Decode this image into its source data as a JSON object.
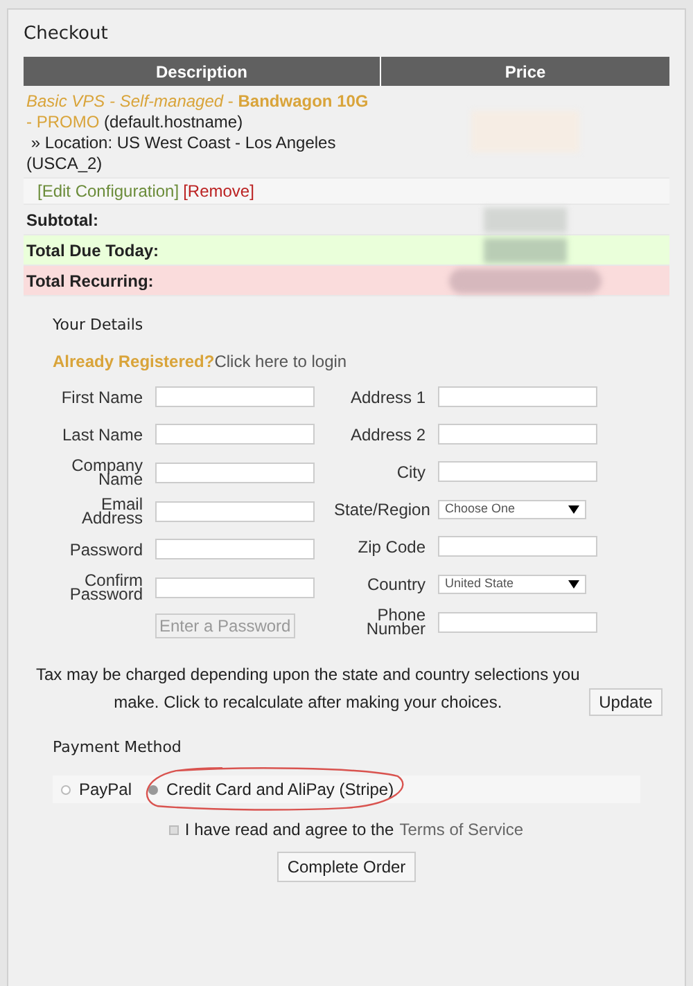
{
  "title": "Checkout",
  "table": {
    "columns": [
      "Description",
      "Price"
    ],
    "product": {
      "name": "*Basic VPS - Self-managed* - **Bandwagon 10G** - PROMO",
      "hostname": "(default.hostname)",
      "detail": "» Location: US West Coast - Los Angeles (USCA_2)"
    },
    "actions": [
      {
        "label": "[Edit Configuration]",
        "kind": "edit"
      },
      {
        "label": "[Remove]",
        "kind": "remove"
      }
    ],
    "totals": [
      {
        "label": "Subtotal:",
        "kind": "plain"
      },
      {
        "label": "Total Due Today:",
        "kind": "due"
      },
      {
        "label": "Total Recurring:",
        "kind": "recurring"
      }
    ]
  },
  "details": {
    "heading": "Your Details",
    "login_prompt": "Already Registered?",
    "login_link": "Click here to login",
    "left_fields": [
      {
        "label": "First Name",
        "kind": "input"
      },
      {
        "label": "Last Name",
        "kind": "input"
      },
      {
        "label": "Company Name",
        "kind": "input"
      },
      {
        "label": "Email Address",
        "kind": "input"
      },
      {
        "label": "Password",
        "kind": "input"
      },
      {
        "label": "Confirm Password",
        "kind": "input"
      }
    ],
    "password_strength": "Enter a Password",
    "right_fields": [
      {
        "label": "Address 1",
        "kind": "input"
      },
      {
        "label": "Address 2",
        "kind": "input"
      },
      {
        "label": "City",
        "kind": "input"
      },
      {
        "label": "State/Region",
        "kind": "select",
        "value": "Choose One"
      },
      {
        "label": "Zip Code",
        "kind": "input"
      },
      {
        "label": "Country",
        "kind": "select",
        "value": "United State"
      },
      {
        "label": "Phone Number",
        "kind": "input"
      }
    ]
  },
  "tax_note": "Tax may be charged depending upon the state and country selections you make. Click to recalculate after making your choices.",
  "update_button": "Update",
  "payment": {
    "heading": "Payment Method",
    "options": [
      {
        "label": "PayPal",
        "selected": false
      },
      {
        "label": "Credit Card and AliPay (Stripe)",
        "selected": true
      }
    ]
  },
  "terms": {
    "text": "I have read and agree to the",
    "link": "Terms of Service",
    "checked": false
  },
  "submit_button": "Complete Order"
}
